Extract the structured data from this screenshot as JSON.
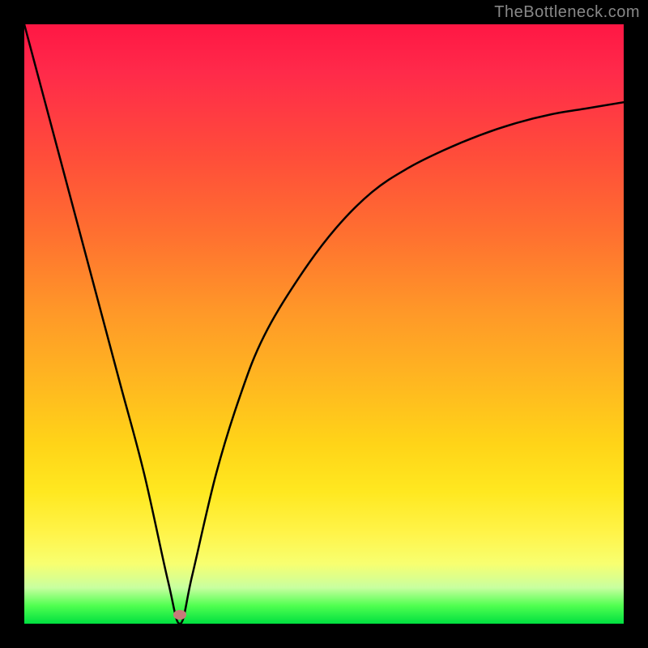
{
  "attribution": "TheBottleneck.com",
  "chart_data": {
    "type": "line",
    "title": "",
    "xlabel": "",
    "ylabel": "",
    "xlim": [
      0,
      100
    ],
    "ylim": [
      0,
      100
    ],
    "grid": false,
    "legend": false,
    "notes": "Bottleneck-style curve: black line plunges from ~100 at x≈0 to ~0 at x≈26 (trough), then rises asymptotically, reaching ~87 at x≈100. Background is a vertical gradient from red (high bottleneck) through orange/yellow to green (no bottleneck) keyed to the y value. A small muted-red oval marker sits at the trough (~x=26, y≈1.5).",
    "series": [
      {
        "name": "bottleneck",
        "x": [
          0,
          4,
          8,
          12,
          16,
          20,
          24,
          26,
          28,
          32,
          36,
          40,
          46,
          52,
          58,
          64,
          70,
          76,
          82,
          88,
          94,
          100
        ],
        "values": [
          100,
          85,
          70,
          55,
          40,
          25,
          7,
          0,
          8,
          25,
          38,
          48,
          58,
          66,
          72,
          76,
          79,
          81.5,
          83.5,
          85,
          86,
          87
        ]
      }
    ],
    "marker": {
      "x": 26,
      "y": 1.5
    },
    "colors": {
      "curve": "#000000",
      "marker": "#c77a7a",
      "gradient_top": "#ff1744",
      "gradient_mid": "#ffd418",
      "gradient_bottom": "#00e040",
      "frame": "#000000"
    }
  }
}
